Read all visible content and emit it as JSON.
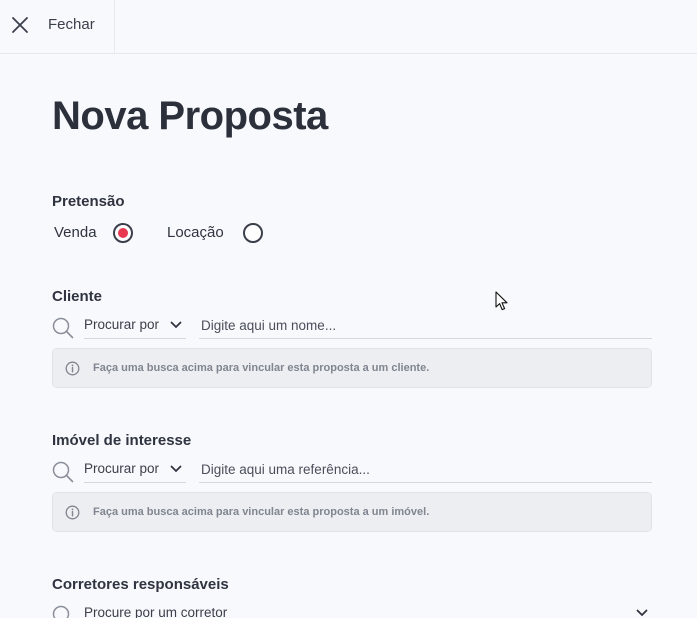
{
  "header": {
    "close_label": "Fechar"
  },
  "page": {
    "title": "Nova Proposta"
  },
  "pretensao": {
    "label": "Pretensão",
    "options": [
      {
        "label": "Venda",
        "checked": true
      },
      {
        "label": "Locação",
        "checked": false
      }
    ],
    "accent_color": "#e8384f"
  },
  "cliente": {
    "label": "Cliente",
    "search_by": "Procurar por",
    "placeholder": "Digite aqui um nome...",
    "info": "Faça uma busca acima para vincular esta proposta a um cliente."
  },
  "imovel": {
    "label": "Imóvel de interesse",
    "search_by": "Procurar por",
    "placeholder": "Digite aqui uma referência...",
    "info": "Faça uma busca acima para vincular esta proposta a um imóvel."
  },
  "corretores": {
    "label": "Corretores responsáveis",
    "placeholder": "Procure por um corretor"
  }
}
